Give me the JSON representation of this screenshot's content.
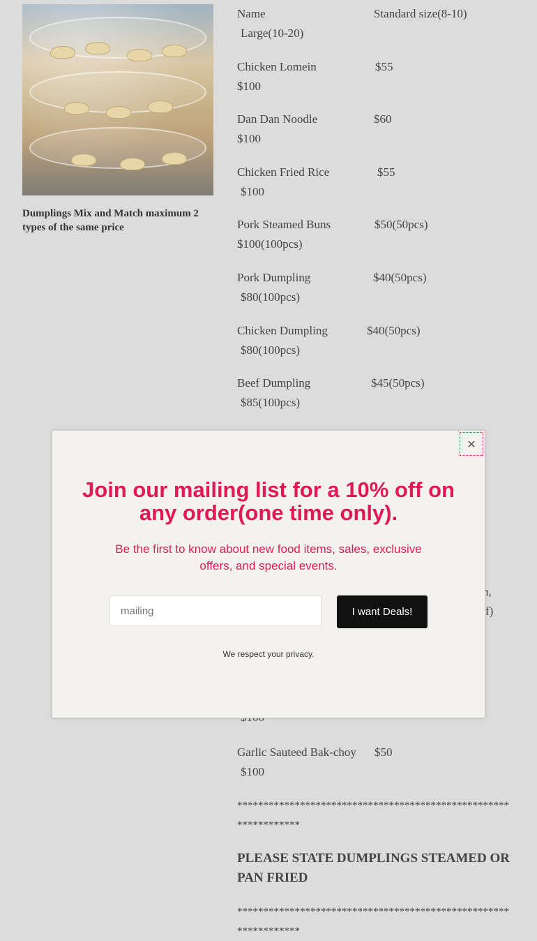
{
  "product": {
    "image_alt": "Dumplings in stacked clear containers",
    "caption": "Dumplings Mix and Match maximum 2 types of the same price"
  },
  "menu": {
    "header": {
      "name": "Name",
      "standard": "Standard size(8-10)",
      "large": "Large(10-20)"
    },
    "items": [
      {
        "name": "Chicken Lomein",
        "standard": "$55",
        "large": "$100"
      },
      {
        "name": "Dan Dan Noodle",
        "standard": "$60",
        "large": "$100"
      },
      {
        "name": "Chicken Fried Rice",
        "standard": "$55",
        "large": "$100"
      },
      {
        "name": "Pork Steamed Buns",
        "standard": "$50(50pcs)",
        "large": "$100(100pcs)"
      },
      {
        "name": "Pork Dumpling",
        "standard": "$40(50pcs)",
        "large": "$80(100pcs)"
      },
      {
        "name": "Chicken Dumpling",
        "standard": "$40(50pcs)",
        "large": "$80(100pcs)"
      },
      {
        "name": "Beef Dumpling",
        "standard": "$45(50pcs)",
        "large": "$85(100pcs)"
      }
    ],
    "partial_behind_modal": {
      "line1_tail": "nch,",
      "line2_tail": "f)",
      "price_below": "$100"
    },
    "garlic": {
      "name": "Garlic Sauteed Bak-choy",
      "standard": "$50",
      "large": "$100"
    },
    "stars": "****************************************************************",
    "notice": "PLEASE STATE DUMPLINGS STEAMED OR PAN FRIED"
  },
  "modal": {
    "close_label": "✕",
    "title": "Join our mailing list for a 10% off on any order(one time only).",
    "subtitle": "Be the first to know about new food items, sales, exclusive offers, and special events.",
    "email_placeholder": "mailing",
    "submit_label": "I want Deals!",
    "privacy": "We respect your privacy."
  },
  "colors": {
    "accent": "#e0195a",
    "button": "#111111",
    "modal_bg": "#f4f2ee",
    "page_overlay": "#dcdcdc"
  }
}
